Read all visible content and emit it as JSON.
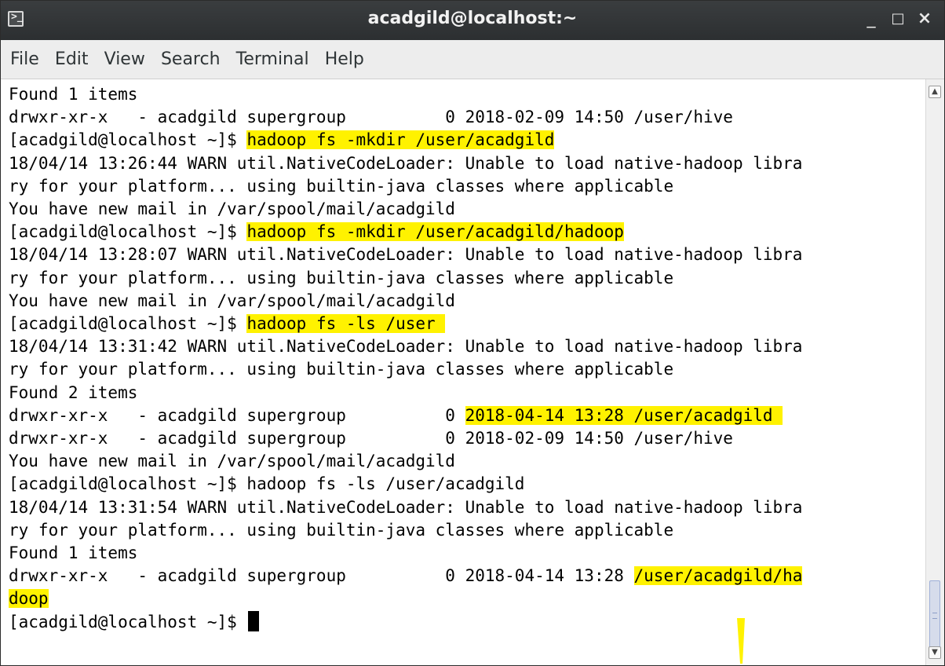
{
  "window": {
    "title": "acadgild@localhost:~",
    "controls": {
      "minimize": "_",
      "maximize": "□",
      "close": "×"
    }
  },
  "menu": [
    "File",
    "Edit",
    "View",
    "Search",
    "Terminal",
    "Help"
  ],
  "terminal": {
    "lines": [
      [
        {
          "t": "Found 1 items"
        }
      ],
      [
        {
          "t": "drwxr-xr-x   - acadgild supergroup          0 2018-02-09 14:50 /user/hive"
        }
      ],
      [
        {
          "t": "[acadgild@localhost ~]$ "
        },
        {
          "t": "hadoop fs -mkdir /user/acadgild",
          "hl": true
        }
      ],
      [
        {
          "t": "18/04/14 13:26:44 WARN util.NativeCodeLoader: Unable to load native-hadoop libra"
        }
      ],
      [
        {
          "t": "ry for your platform... using builtin-java classes where applicable"
        }
      ],
      [
        {
          "t": "You have new mail in /var/spool/mail/acadgild"
        }
      ],
      [
        {
          "t": "[acadgild@localhost ~]$ "
        },
        {
          "t": "hadoop fs -mkdir /user/acadgild/hadoop",
          "hl": true
        }
      ],
      [
        {
          "t": "18/04/14 13:28:07 WARN util.NativeCodeLoader: Unable to load native-hadoop libra"
        }
      ],
      [
        {
          "t": "ry for your platform... using builtin-java classes where applicable"
        }
      ],
      [
        {
          "t": "You have new mail in /var/spool/mail/acadgild"
        }
      ],
      [
        {
          "t": "[acadgild@localhost ~]$ "
        },
        {
          "t": "hadoop fs -ls /user ",
          "hl": true
        }
      ],
      [
        {
          "t": "18/04/14 13:31:42 WARN util.NativeCodeLoader: Unable to load native-hadoop libra"
        }
      ],
      [
        {
          "t": "ry for your platform... using builtin-java classes where applicable"
        }
      ],
      [
        {
          "t": "Found 2 items"
        }
      ],
      [
        {
          "t": "drwxr-xr-x   - acadgild supergroup          0 "
        },
        {
          "t": "2018-04-14 13:28 /user/acadgild ",
          "hl": true
        }
      ],
      [
        {
          "t": "drwxr-xr-x   - acadgild supergroup          0 2018-02-09 14:50 /user/hive"
        }
      ],
      [
        {
          "t": "You have new mail in /var/spool/mail/acadgild"
        }
      ],
      [
        {
          "t": "[acadgild@localhost ~]$ hadoop fs -ls /user/acadgild"
        }
      ],
      [
        {
          "t": "18/04/14 13:31:54 WARN util.NativeCodeLoader: Unable to load native-hadoop libra"
        }
      ],
      [
        {
          "t": "ry for your platform... using builtin-java classes where applicable"
        }
      ],
      [
        {
          "t": "Found 1 items"
        }
      ],
      [
        {
          "t": "drwxr-xr-x   - acadgild supergroup          0 2018-04-14 13:28 "
        },
        {
          "t": "/user/acadgild/ha",
          "hl": true
        }
      ],
      [
        {
          "t": "doop",
          "hl": true
        }
      ],
      [
        {
          "t": "[acadgild@localhost ~]$ "
        },
        {
          "cursor": true
        }
      ]
    ]
  },
  "colors": {
    "highlight": "#fff200",
    "titlebar": "#2f3234",
    "menubar": "#ededed",
    "text": "#000000"
  },
  "icons": {
    "app": "terminal-icon",
    "scroll_up": "chevron-up-icon",
    "scroll_down": "chevron-down-icon"
  }
}
